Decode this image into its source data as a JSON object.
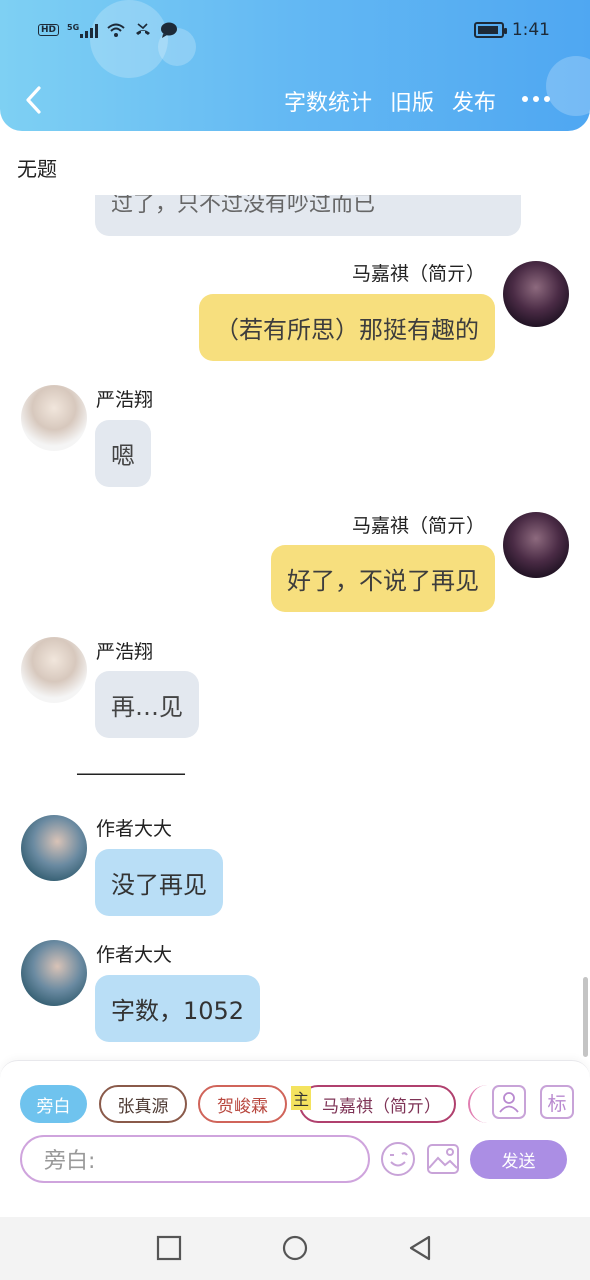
{
  "status_bar": {
    "left_label": "HD",
    "network": "5G",
    "time": "1:41"
  },
  "nav": {
    "actions": [
      "字数统计",
      "旧版",
      "发布"
    ]
  },
  "doc": {
    "title": "无题"
  },
  "messages": {
    "partial": "过了，只不过没有吵过而已",
    "m1": {
      "name": "马嘉祺（简亓）",
      "text": "（若有所思）那挺有趣的"
    },
    "m2": {
      "name": "严浩翔",
      "text": "嗯"
    },
    "m3": {
      "name": "马嘉祺（简亓）",
      "text": "好了，不说了再见"
    },
    "m4": {
      "name": "严浩翔",
      "text": "再…见"
    },
    "divider": "——————",
    "m5": {
      "name": "作者大大",
      "text": "没了再见"
    },
    "m6": {
      "name": "作者大大",
      "text": "字数，1052"
    }
  },
  "composer": {
    "chips": [
      "旁白",
      "张真源",
      "贺峻霖",
      "马嘉祺（简亓）"
    ],
    "main_tag": "主",
    "tag_button": "标",
    "input_placeholder": "旁白:",
    "send_label": "发送"
  },
  "colors": {
    "header_start": "#7ed0f3",
    "header_end": "#4fa7f2",
    "bubble_yellow": "#f7df7e",
    "bubble_grey": "#e3e8ef",
    "bubble_blue": "#b9def6",
    "send": "#ab8ee4"
  }
}
